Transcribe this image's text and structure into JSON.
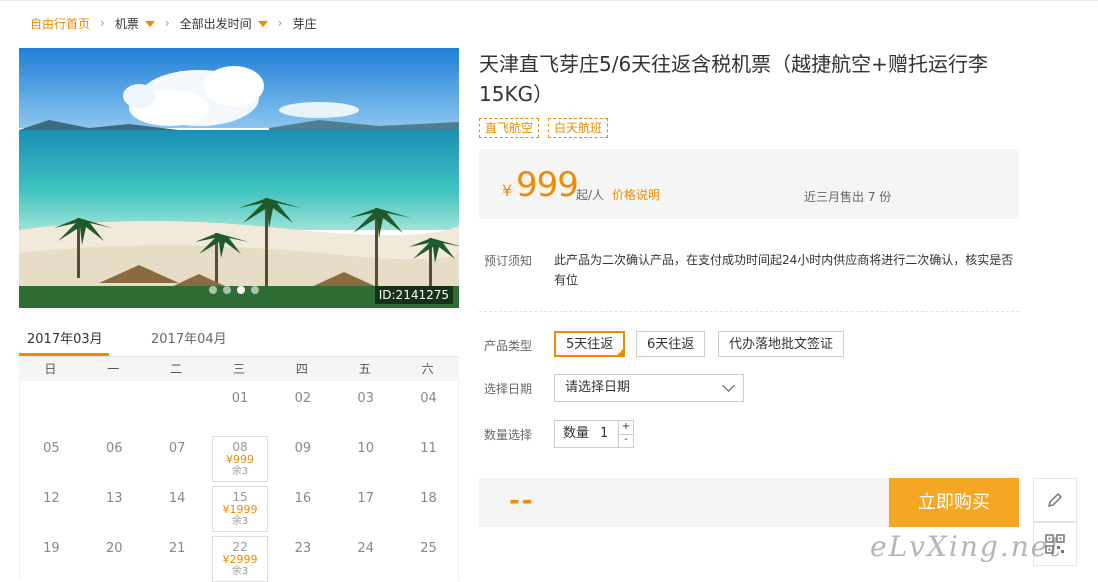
{
  "breadcrumb": {
    "home": "自由行首页",
    "category": "机票",
    "departure": "全部出发时间",
    "destination": "芽庄"
  },
  "hero": {
    "image_id": "ID:2141275",
    "slide_count": 4,
    "active_slide": 3
  },
  "calendar": {
    "tabs": [
      "2017年03月",
      "2017年04月"
    ],
    "active_tab": 0,
    "weekdays": [
      "日",
      "一",
      "二",
      "三",
      "四",
      "五",
      "六"
    ],
    "days": [
      {
        "day": "01",
        "col": 3,
        "row": 0
      },
      {
        "day": "02",
        "col": 4,
        "row": 0
      },
      {
        "day": "03",
        "col": 5,
        "row": 0
      },
      {
        "day": "04",
        "col": 6,
        "row": 0
      },
      {
        "day": "05",
        "col": 0,
        "row": 1
      },
      {
        "day": "06",
        "col": 1,
        "row": 1
      },
      {
        "day": "07",
        "col": 2,
        "row": 1
      },
      {
        "day": "08",
        "col": 3,
        "row": 1,
        "price": "¥999",
        "stock": "余3"
      },
      {
        "day": "09",
        "col": 4,
        "row": 1
      },
      {
        "day": "10",
        "col": 5,
        "row": 1
      },
      {
        "day": "11",
        "col": 6,
        "row": 1
      },
      {
        "day": "12",
        "col": 0,
        "row": 2
      },
      {
        "day": "13",
        "col": 1,
        "row": 2
      },
      {
        "day": "14",
        "col": 2,
        "row": 2
      },
      {
        "day": "15",
        "col": 3,
        "row": 2,
        "price": "¥1999",
        "stock": "余3"
      },
      {
        "day": "16",
        "col": 4,
        "row": 2
      },
      {
        "day": "17",
        "col": 5,
        "row": 2
      },
      {
        "day": "18",
        "col": 6,
        "row": 2
      },
      {
        "day": "19",
        "col": 0,
        "row": 3
      },
      {
        "day": "20",
        "col": 1,
        "row": 3
      },
      {
        "day": "21",
        "col": 2,
        "row": 3
      },
      {
        "day": "22",
        "col": 3,
        "row": 3,
        "price": "¥2999",
        "stock": "余3"
      },
      {
        "day": "23",
        "col": 4,
        "row": 3
      },
      {
        "day": "24",
        "col": 5,
        "row": 3
      },
      {
        "day": "25",
        "col": 6,
        "row": 3
      }
    ]
  },
  "product": {
    "title": "天津直飞芽庄5/6天往返含税机票（越捷航空+赠托运行李15KG）",
    "tags": [
      "直飞航空",
      "白天航班"
    ],
    "currency": "¥",
    "price": "999",
    "per_person": "起/人",
    "price_note": "价格说明",
    "sold": "近三月售出 7 份"
  },
  "booking": {
    "notice_label": "预订须知",
    "notice_text": "此产品为二次确认产品，在支付成功时间起24小时内供应商将进行二次确认，核实是否有位",
    "type_label": "产品类型",
    "type_options": [
      "5天往返",
      "6天往返",
      "代办落地批文签证"
    ],
    "selected_type": 0,
    "date_label": "选择日期",
    "date_placeholder": "请选择日期",
    "qty_label": "数量选择",
    "qty_inner_label": "数量",
    "qty_value": "1",
    "qty_plus": "+",
    "qty_minus": "-",
    "total": "--",
    "buy_label": "立即购买"
  },
  "sidebar": {
    "edit_icon": "pencil-icon",
    "qr_icon": "qr-code-icon"
  },
  "watermark": "eLvXing.net",
  "colors": {
    "accent": "#f08a00",
    "buy_button": "#f5a623",
    "panel_bg": "#f5f5f5"
  }
}
